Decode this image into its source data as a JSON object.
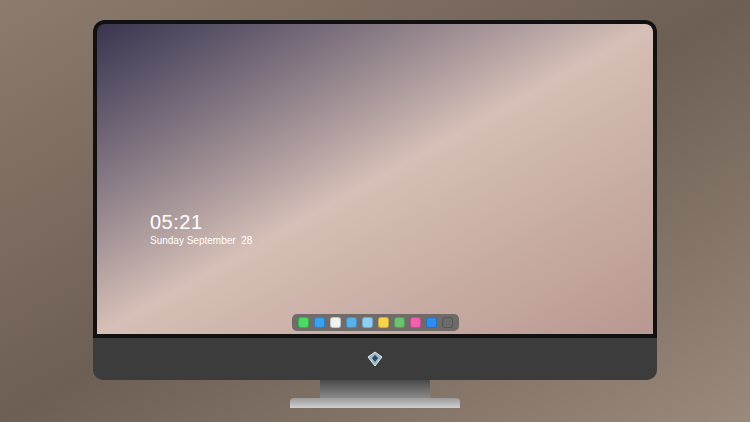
{
  "clock": {
    "time": "05:21",
    "date": "Sunday September  28"
  },
  "dock": {
    "items": [
      {
        "color": "#4cd964"
      },
      {
        "color": "#3aa0f0"
      },
      {
        "color": "#f2f2f2"
      },
      {
        "color": "#5ab0e8"
      },
      {
        "color": "#8fd0f0"
      },
      {
        "color": "#f7d54a"
      },
      {
        "color": "#6cc070"
      },
      {
        "color": "#f062b0"
      },
      {
        "color": "#2f8cf0"
      },
      {
        "color": "#6b6b6b"
      }
    ]
  }
}
